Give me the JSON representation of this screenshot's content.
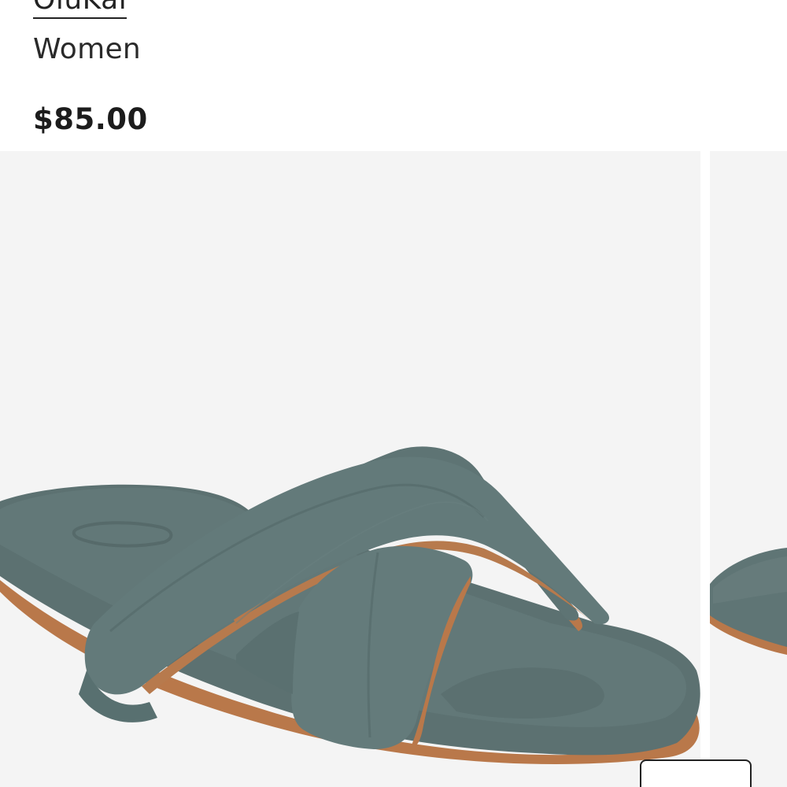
{
  "product": {
    "brand": "OluKai",
    "category": "Women",
    "price": "$85.00"
  },
  "gallery": {
    "images": [
      {
        "name": "sandal-image",
        "icon": "product-photo"
      },
      {
        "name": "sandal-image-next",
        "icon": "product-photo"
      }
    ]
  },
  "colors": {
    "sandal": "#5f7474",
    "sole": "#b9784a",
    "background": "#f4f4f4"
  }
}
